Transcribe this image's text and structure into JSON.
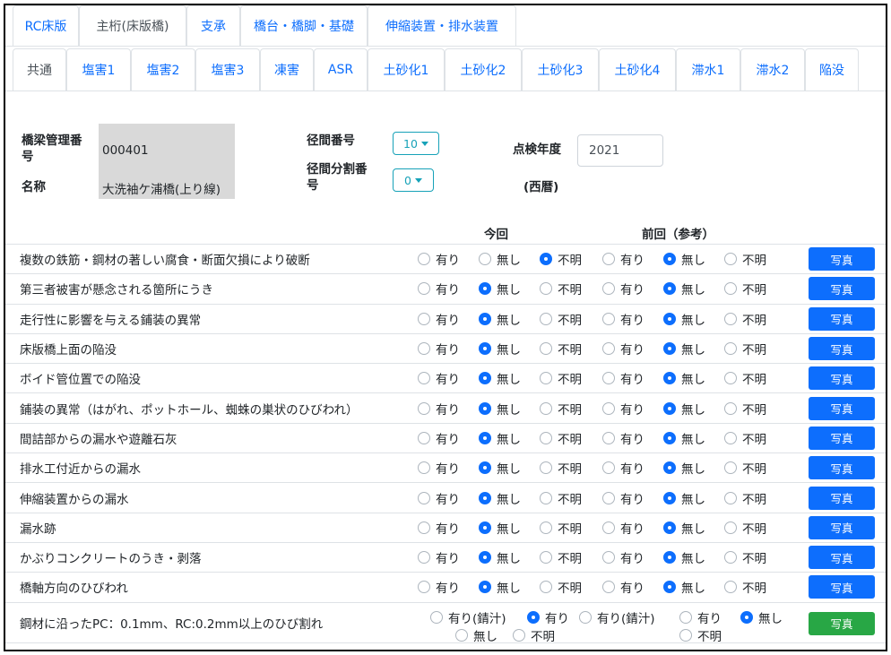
{
  "tabs_main": [
    "RC床版",
    "主桁(床版橋)",
    "支承",
    "橋台・橋脚・基礎",
    "伸縮装置・排水装置"
  ],
  "tabs_main_active": 1,
  "tabs_sub": [
    "共通",
    "塩害1",
    "塩害2",
    "塩害3",
    "凍害",
    "ASR",
    "土砂化1",
    "土砂化2",
    "土砂化3",
    "土砂化4",
    "滞水1",
    "滞水2",
    "陥没"
  ],
  "tabs_sub_active": 0,
  "info": {
    "bridge_id_label": "橋梁管理番号",
    "bridge_id_value": "000401",
    "name_label": "名称",
    "name_value": "大洗袖ケ浦橋(上り線)",
    "span_label": "径間番号",
    "span_value": "10",
    "span_div_label": "径間分割番号",
    "span_div_value": "0",
    "year_label": "点検年度",
    "year_value": "2021",
    "year_note": "(西暦)"
  },
  "headers": {
    "current": "今回",
    "previous": "前回（参考）"
  },
  "options": {
    "yes": "有り",
    "no": "無し",
    "unknown": "不明",
    "yes_rust": "有り(錆汁)"
  },
  "photo_label": "写真",
  "rows": [
    {
      "label": "複数の鉄筋・鋼材の著しい腐食・断面欠損により破断",
      "current": "unknown",
      "previous": "no"
    },
    {
      "label": "第三者被害が懸念される箇所にうき",
      "current": "no",
      "previous": "no"
    },
    {
      "label": "走行性に影響を与える鋪装の異常",
      "current": "no",
      "previous": "no"
    },
    {
      "label": "床版橋上面の陥没",
      "current": "no",
      "previous": "no"
    },
    {
      "label": "ボイド管位置での陥没",
      "current": "no",
      "previous": "no"
    },
    {
      "label": "鋪装の異常（はがれ、ポットホール、蜘蛛の巣状のひびわれ）",
      "current": "no",
      "previous": "no"
    },
    {
      "label": "間詰部からの漏水や遊離石灰",
      "current": "no",
      "previous": "no"
    },
    {
      "label": "排水工付近からの漏水",
      "current": "no",
      "previous": "no"
    },
    {
      "label": "伸縮装置からの漏水",
      "current": "no",
      "previous": "no"
    },
    {
      "label": "漏水跡",
      "current": "no",
      "previous": "no"
    },
    {
      "label": "かぶりコンクリートのうき・剥落",
      "current": "no",
      "previous": "no"
    },
    {
      "label": "橋軸方向のひびわれ",
      "current": "no",
      "previous": "no"
    }
  ],
  "last_row": {
    "label": "鋼材に沿ったPC：0.1mm、RC:0.2mm以上のひび割れ",
    "current": "yes",
    "previous": "no"
  },
  "colors": {
    "primary": "#0d6efd",
    "success": "#28a745",
    "info": "#17a2b8",
    "readonly_bg": "#d9d9d9"
  }
}
